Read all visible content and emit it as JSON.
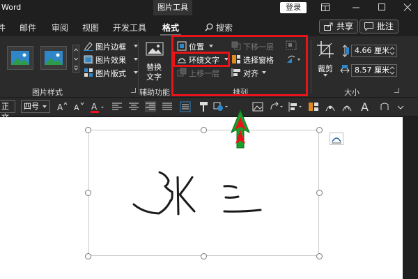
{
  "titlebar": {
    "app_name": "Word",
    "context_tab": "图片工具",
    "login": "登录"
  },
  "tabs": {
    "items": [
      "件",
      "邮件",
      "审阅",
      "视图",
      "开发工具",
      "格式"
    ],
    "active": "格式",
    "search": "搜索",
    "share": "共享",
    "comments": "批注"
  },
  "ribbon": {
    "picture_styles": {
      "label": "图片样式",
      "border": "图片边框",
      "effects": "图片效果",
      "layout": "图片版式"
    },
    "accessibility": {
      "alt_text_line1": "替换",
      "alt_text_line2": "文字",
      "label": "辅助功能"
    },
    "arrange": {
      "position": "位置",
      "wrap_text": "环绕文字",
      "bring_forward": "上移一层",
      "send_backward": "下移一层",
      "selection_pane": "选择窗格",
      "align": "对齐",
      "label": "排列"
    },
    "size": {
      "crop": "裁剪",
      "height": "4.66 厘米",
      "width": "8.57 厘米",
      "label": "大小"
    }
  },
  "format_bar": {
    "style_combo": "正文",
    "size_combo": "四号"
  },
  "document": {
    "signature_text": "张三"
  },
  "colors": {
    "highlight": "#e8141a",
    "arrow_fill": "#1a9f2a",
    "arrow_inner": "#e8141a",
    "picture_blue": "#2f86c8"
  }
}
